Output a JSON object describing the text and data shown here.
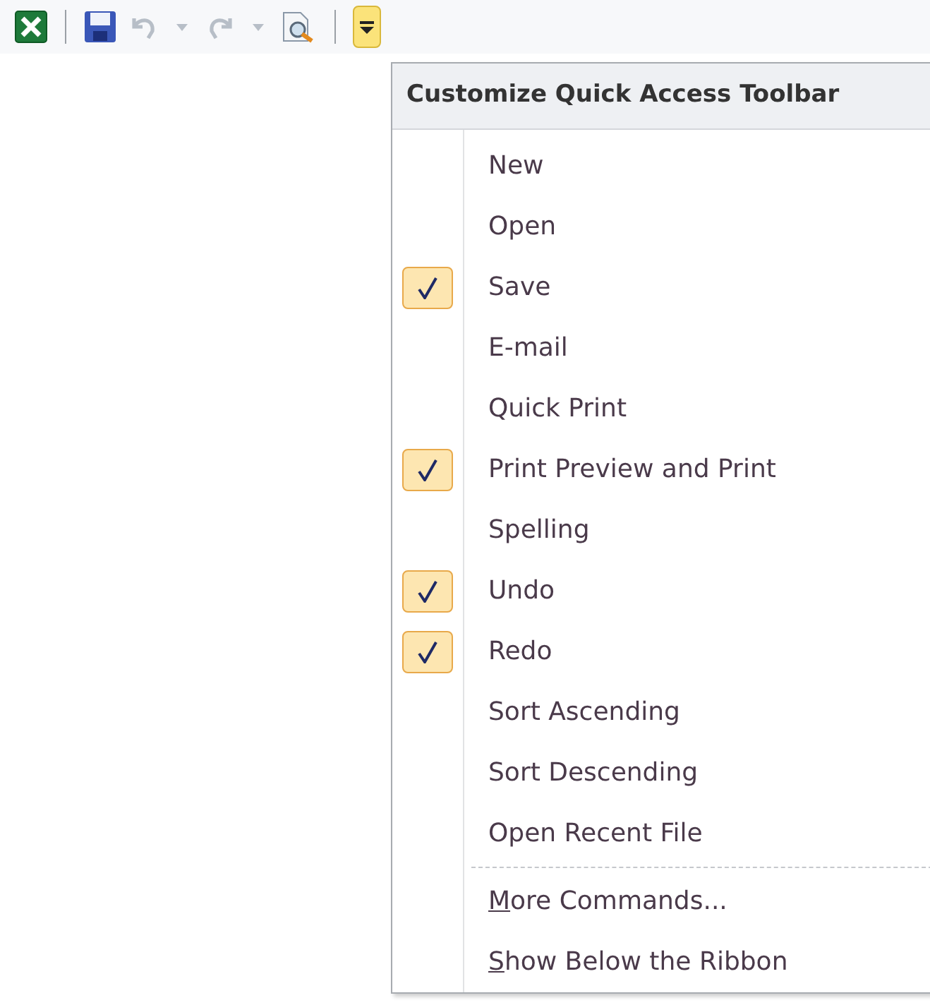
{
  "toolbar": {
    "buttons": [
      {
        "kind": "excel"
      },
      {
        "kind": "sep"
      },
      {
        "kind": "save"
      },
      {
        "kind": "undo",
        "disabled": true
      },
      {
        "kind": "dropdown",
        "disabled": true
      },
      {
        "kind": "redo",
        "disabled": true
      },
      {
        "kind": "dropdown",
        "disabled": true
      },
      {
        "kind": "preview"
      },
      {
        "kind": "sep"
      },
      {
        "kind": "customize",
        "selected": true
      }
    ]
  },
  "menu": {
    "title": "Customize Quick Access Toolbar",
    "items": [
      {
        "label": "New",
        "checked": false
      },
      {
        "label": "Open",
        "checked": false
      },
      {
        "label": "Save",
        "checked": true
      },
      {
        "label": "E-mail",
        "checked": false
      },
      {
        "label": "Quick Print",
        "checked": false
      },
      {
        "label": "Print Preview and Print",
        "checked": true
      },
      {
        "label": "Spelling",
        "checked": false
      },
      {
        "label": "Undo",
        "checked": true
      },
      {
        "label": "Redo",
        "checked": true
      },
      {
        "label": "Sort Ascending",
        "checked": false
      },
      {
        "label": "Sort Descending",
        "checked": false
      },
      {
        "label": "Open Recent File",
        "checked": false
      }
    ],
    "commands": [
      {
        "label": "More Commands...",
        "underline_first": true
      },
      {
        "label": "Show Below the Ribbon",
        "underline_first": true
      }
    ]
  }
}
